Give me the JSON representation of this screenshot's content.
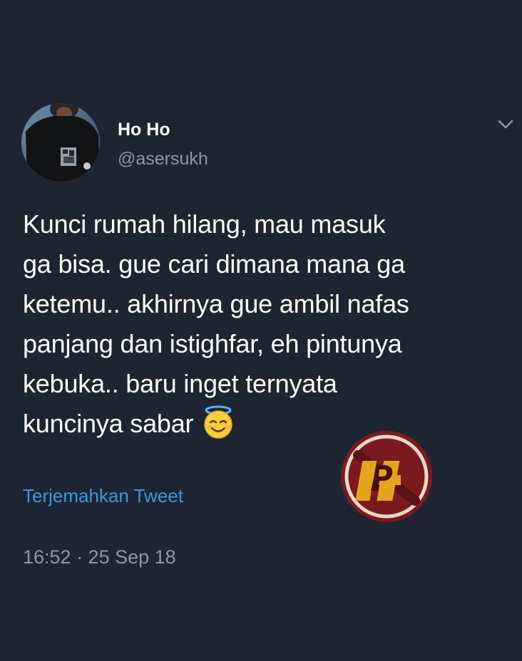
{
  "user": {
    "display_name": "Ho Ho",
    "handle": "@asersukh"
  },
  "tweet": {
    "lines": [
      "Kunci rumah hilang, mau masuk",
      "ga bisa. gue cari dimana mana ga",
      "ketemu.. akhirnya gue ambil nafas",
      "panjang dan istighfar, eh pintunya",
      "kebuka.. baru inget ternyata",
      "kuncinya sabar"
    ],
    "emoji": "smiling-face-with-halo",
    "translate_label": "Terjemahkan Tweet",
    "timestamp": "16:52 · 25 Sep 18"
  },
  "watermark": {
    "logo_text": "PH"
  },
  "icons": {
    "menu": "chevron-down-icon"
  },
  "colors": {
    "background": "#1c2531",
    "text": "#ffffff",
    "secondary_text": "#8b98a5",
    "link": "#3a9ad9",
    "watermark_red": "#7a1a1f",
    "watermark_gold": "#e2a51b"
  }
}
